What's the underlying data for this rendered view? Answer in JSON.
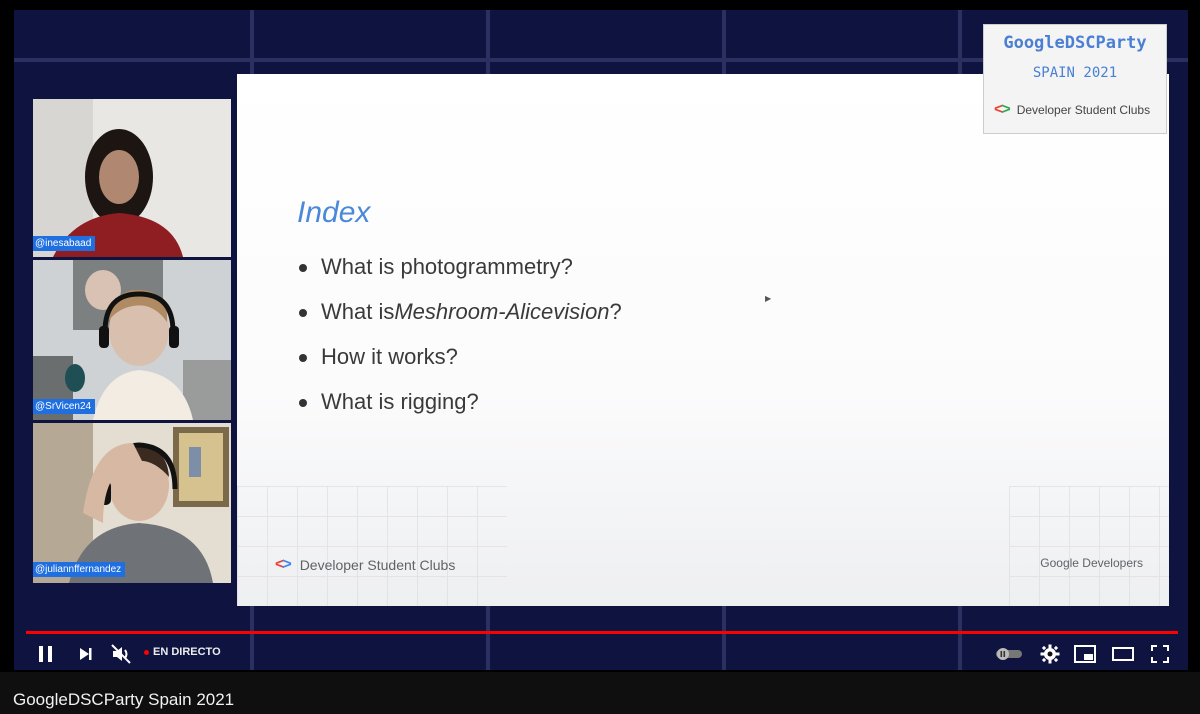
{
  "slide": {
    "title": "Index",
    "bullets": [
      {
        "prefix": "What is  photogrammetry?",
        "em": "",
        "suffix": ""
      },
      {
        "prefix": "What is ",
        "em": "Meshroom-Alicevision",
        "suffix": "?"
      },
      {
        "prefix": "How it works?",
        "em": "",
        "suffix": ""
      },
      {
        "prefix": "What is rigging?",
        "em": "",
        "suffix": ""
      }
    ],
    "footer_left": "Developer Student Clubs",
    "footer_right": "Google Developers"
  },
  "brand": {
    "title": "GoogleDSCParty",
    "subtitle": "SPAIN 2021",
    "org": "Developer Student Clubs"
  },
  "participants": [
    {
      "handle": "@inesabaad"
    },
    {
      "handle": "@SrVicen24"
    },
    {
      "handle": "@juliannffernandez"
    }
  ],
  "player": {
    "live_label": "EN DIRECTO",
    "video_title": "GoogleDSCParty Spain 2021",
    "progress": 1.0,
    "accent": "#ff0000"
  },
  "icons": {
    "pause": "pause-icon",
    "next": "next-icon",
    "mute": "volume-muted-icon",
    "autoplay": "autoplay-toggle-icon",
    "settings": "gear-icon",
    "miniplayer": "miniplayer-icon",
    "theater": "theater-mode-icon",
    "fullscreen": "fullscreen-icon"
  }
}
